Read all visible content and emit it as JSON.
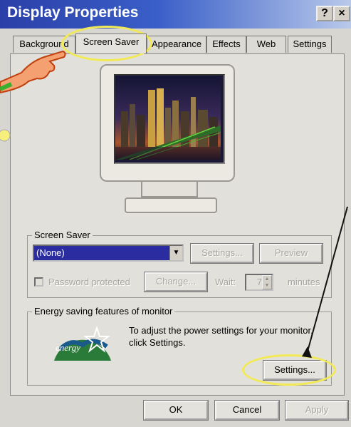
{
  "window": {
    "title": "Display Properties",
    "help_button": "?",
    "close_button": "×"
  },
  "tabs": [
    {
      "label": "Background"
    },
    {
      "label": "Screen Saver"
    },
    {
      "label": "Appearance"
    },
    {
      "label": "Effects"
    },
    {
      "label": "Web"
    },
    {
      "label": "Settings"
    }
  ],
  "active_tab": "Screen Saver",
  "screen_saver": {
    "group_label": "Screen Saver",
    "selected": "(None)",
    "settings_button": "Settings...",
    "preview_button": "Preview",
    "password_label": "Password protected",
    "password_checked": false,
    "change_button": "Change...",
    "wait_label": "Wait:",
    "wait_value": "7",
    "minutes_label": "minutes"
  },
  "energy": {
    "group_label": "Energy saving features of monitor",
    "logo_text": "energy",
    "description_line1": "To adjust the power settings for your monitor,",
    "description_line2": "click Settings.",
    "settings_button": "Settings..."
  },
  "dialog_buttons": {
    "ok": "OK",
    "cancel": "Cancel",
    "apply": "Apply"
  },
  "colors": {
    "titlebar_start": "#2b3fa8",
    "highlight": "#f2ea55",
    "selection": "#2a2ca0"
  }
}
